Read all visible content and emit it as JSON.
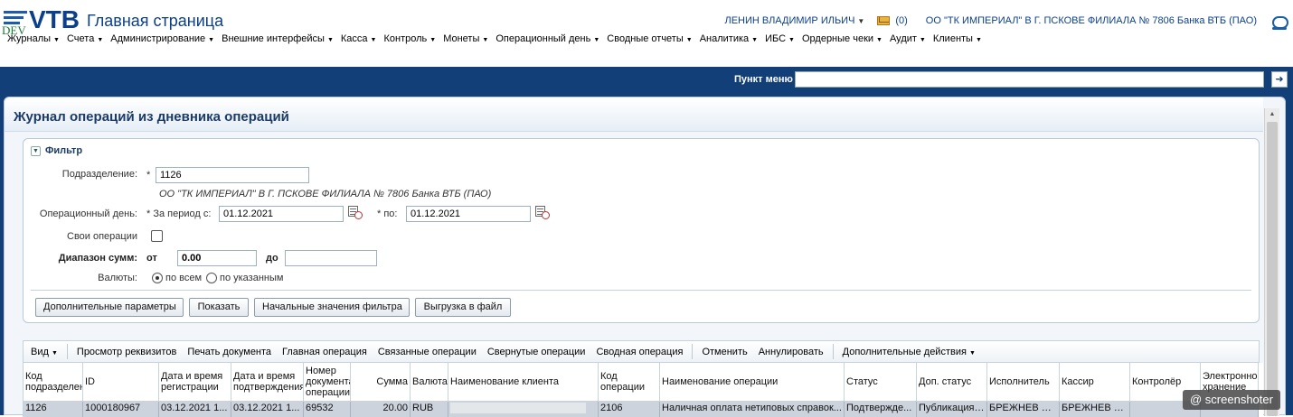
{
  "header": {
    "logo_dev": "DEV",
    "logo_vtb": "VTB",
    "title": "Главная страница",
    "user": "ЛЕНИН ВЛАДИМИР ИЛЬИЧ",
    "mail_count": "(0)",
    "org": "ОО \"ТК ИМПЕРИАЛ\" В Г. ПСКОВЕ ФИЛИАЛА № 7806 Банка ВТБ (ПАО)"
  },
  "menu": [
    "Журналы",
    "Счета",
    "Администрирование",
    "Внешние интерфейсы",
    "Касса",
    "Контроль",
    "Монеты",
    "Операционный день",
    "Сводные отчеты",
    "Аналитика",
    "ИБС",
    "Ордерные чеки",
    "Аудит",
    "Клиенты"
  ],
  "menu_search": {
    "label": "Пункт меню",
    "value": ""
  },
  "panel": {
    "title": "Журнал операций из дневника операций"
  },
  "filter": {
    "title": "Фильтр",
    "division_label": "Подразделение:",
    "division_value": "1126",
    "division_name": "ОО \"ТК ИМПЕРИАЛ\" В Г. ПСКОВЕ ФИЛИАЛА № 7806 Банка ВТБ (ПАО)",
    "opday_label": "Операционный день:",
    "period_from_label": "* За период с:",
    "period_from_value": "01.12.2021",
    "period_to_label": "* по:",
    "period_to_value": "01.12.2021",
    "own_ops_label": "Свои операции",
    "range_label": "Диапазон сумм:",
    "range_from_label": "от",
    "range_from_value": "0.00",
    "range_to_label": "до",
    "range_to_value": "",
    "currency_label": "Валюты:",
    "currency_all": "по всем",
    "currency_selected": "по указанным",
    "required_mark": "*"
  },
  "buttons": {
    "extra_params": "Дополнительные параметры",
    "show": "Показать",
    "reset": "Начальные значения фильтра",
    "export": "Выгрузка в файл"
  },
  "toolbar": {
    "view": "Вид",
    "details": "Просмотр реквизитов",
    "print": "Печать документа",
    "main_op": "Главная операция",
    "linked_ops": "Связанные операции",
    "collapsed_ops": "Свернутые операции",
    "summary_op": "Сводная операция",
    "cancel": "Отменить",
    "annul": "Аннулировать",
    "more": "Дополнительные действия"
  },
  "table": {
    "columns": [
      "Код подразделения",
      "ID",
      "Дата и время регистрации",
      "Дата и время подтверждения",
      "Номер документа операции",
      "Сумма",
      "Валюта",
      "Наименование клиента",
      "Код операции",
      "Наименование операции",
      "Статус",
      "Доп. статус",
      "Исполнитель",
      "Кассир",
      "Контролёр",
      "Электронное хранение"
    ],
    "rows": [
      [
        "1126",
        "1000180967",
        "03.12.2021 1...",
        "03.12.2021 1...",
        "69532",
        "20.00",
        "RUB",
        "",
        "2106",
        "Наличная оплата нетиповых справок...",
        "Подтвержде...",
        "Публикация ...",
        "БРЕЖНЕВ Л.И.",
        "БРЕЖНЕВ Л.И.",
        "",
        ""
      ]
    ]
  },
  "watermark": "@ screenshoter"
}
